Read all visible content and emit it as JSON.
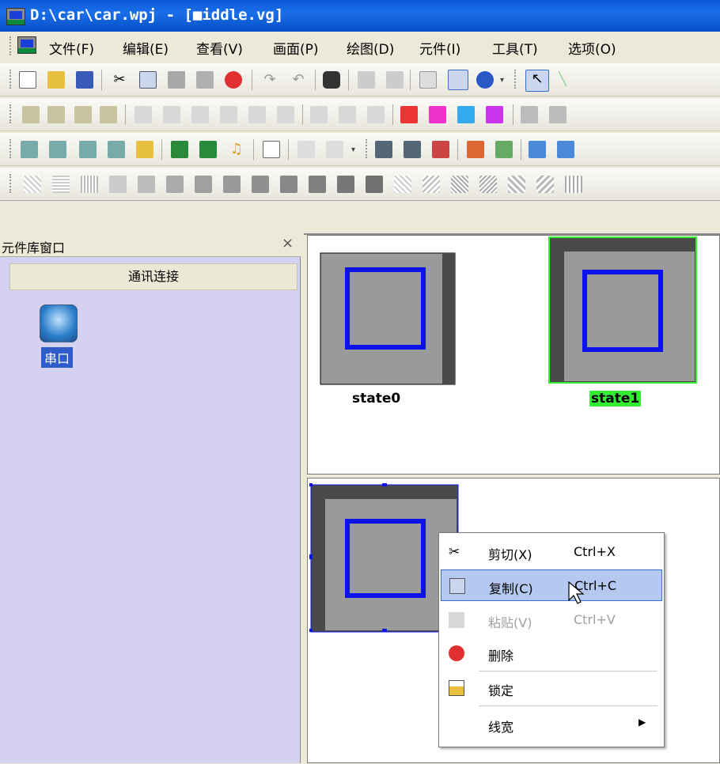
{
  "window": {
    "title": "D:\\car\\car.wpj - [■iddle.vg]"
  },
  "menubar": {
    "items": [
      "文件(F)",
      "编辑(E)",
      "查看(V)",
      "画面(P)",
      "绘图(D)",
      "元件(I)",
      "工具(T)",
      "选项(O)"
    ]
  },
  "library_panel": {
    "title": "元件库窗口",
    "close": "×",
    "category": "通讯连接",
    "items": [
      {
        "label": "串口",
        "icon": "serial-port-icon"
      }
    ]
  },
  "states": [
    {
      "label": "state0",
      "selected": false
    },
    {
      "label": "state1",
      "selected": true
    }
  ],
  "context_menu": {
    "items": [
      {
        "label": "剪切(X)",
        "shortcut": "Ctrl+X",
        "icon": "scissors-icon",
        "enabled": true,
        "highlighted": false
      },
      {
        "label": "复制(C)",
        "shortcut": "Ctrl+C",
        "icon": "copy-icon",
        "enabled": true,
        "highlighted": true
      },
      {
        "label": "粘贴(V)",
        "shortcut": "Ctrl+V",
        "icon": "paste-icon",
        "enabled": false,
        "highlighted": false
      },
      {
        "label": "删除",
        "shortcut": "",
        "icon": "delete-icon",
        "enabled": true,
        "highlighted": false
      },
      {
        "label": "锁定",
        "shortcut": "",
        "icon": "lock-icon",
        "enabled": true,
        "highlighted": false
      },
      {
        "label": "线宽",
        "shortcut": "",
        "icon": "submenu-arrow-icon",
        "enabled": true,
        "highlighted": false
      }
    ]
  },
  "colors": {
    "titlebar": "#0a5ad8",
    "selection": "#33ee33",
    "shape_blue": "#0a14e8",
    "shape_gray": "#9a9a9a",
    "shape_dark": "#4a4a4a",
    "panel_bg": "#d4d2f0",
    "menu_highlight": "#b5c8ef"
  }
}
